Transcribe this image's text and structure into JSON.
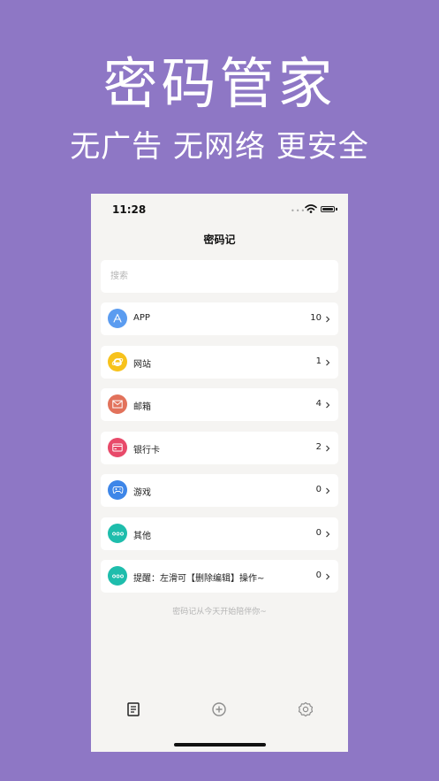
{
  "promo": {
    "title": "密码管家",
    "subtitle": "无广告 无网络 更安全"
  },
  "status_bar": {
    "time": "11:28"
  },
  "nav": {
    "title": "密码记"
  },
  "search": {
    "placeholder": "搜索",
    "value": ""
  },
  "categories": [
    {
      "label": "APP",
      "count": "10",
      "icon": "app-store-icon",
      "color": "#5b9cf0"
    },
    {
      "label": "网站",
      "count": "1",
      "icon": "ie-browser-icon",
      "color": "#f7c21c"
    },
    {
      "label": "邮箱",
      "count": "4",
      "icon": "mail-icon",
      "color": "#e2725b"
    },
    {
      "label": "银行卡",
      "count": "2",
      "icon": "bank-card-icon",
      "color": "#e84a6a"
    },
    {
      "label": "游戏",
      "count": "0",
      "icon": "gamepad-icon",
      "color": "#3e86e8"
    },
    {
      "label": "其他",
      "count": "0",
      "icon": "more-dots-icon",
      "color": "#1ebdac"
    },
    {
      "label": "提醒：左滑可【删除编辑】操作~",
      "count": "0",
      "icon": "more-dots-icon",
      "color": "#1ebdac"
    }
  ],
  "footer_note": "密码记从今天开始陪伴你~",
  "tabbar": {
    "tabs": [
      {
        "icon": "document-list-icon",
        "active": true
      },
      {
        "icon": "add-circle-icon",
        "active": false
      },
      {
        "icon": "gear-icon",
        "active": false
      }
    ]
  }
}
